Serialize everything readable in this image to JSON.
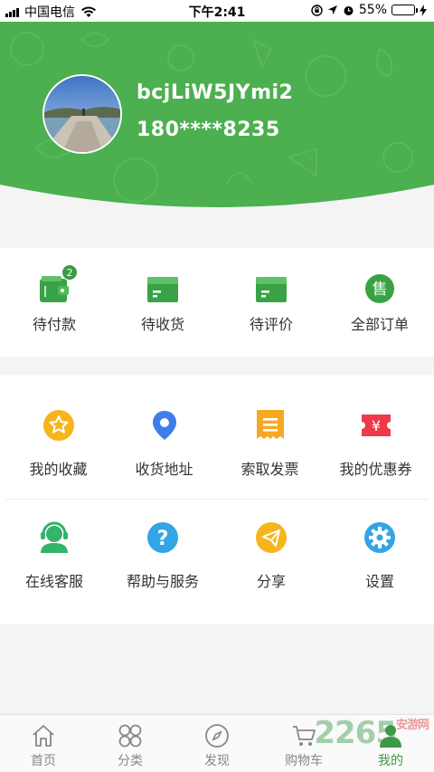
{
  "status_bar": {
    "carrier": "中国电信",
    "time": "下午2:41",
    "battery": "55%",
    "battery_level": 0.55
  },
  "profile": {
    "username": "bcjLiW5JYmi2",
    "phone": "180****8235"
  },
  "orders": [
    {
      "label": "待付款",
      "icon": "wallet-icon",
      "badge": "2"
    },
    {
      "label": "待收货",
      "icon": "box-icon"
    },
    {
      "label": "待评价",
      "icon": "box-icon"
    },
    {
      "label": "全部订单",
      "icon": "sell-icon",
      "glyph": "售"
    }
  ],
  "services_row1": [
    {
      "label": "我的收藏",
      "icon": "star-icon"
    },
    {
      "label": "收货地址",
      "icon": "location-pin-icon"
    },
    {
      "label": "索取发票",
      "icon": "invoice-icon"
    },
    {
      "label": "我的优惠券",
      "icon": "coupon-icon",
      "glyph": "¥"
    }
  ],
  "services_row2": [
    {
      "label": "在线客服",
      "icon": "customer-service-icon"
    },
    {
      "label": "帮助与服务",
      "icon": "help-icon",
      "glyph": "?"
    },
    {
      "label": "分享",
      "icon": "share-icon"
    },
    {
      "label": "设置",
      "icon": "settings-gear-icon"
    }
  ],
  "tabs": [
    {
      "label": "首页",
      "icon": "home-icon"
    },
    {
      "label": "分类",
      "icon": "category-icon"
    },
    {
      "label": "发现",
      "icon": "compass-icon"
    },
    {
      "label": "购物车",
      "icon": "cart-icon"
    },
    {
      "label": "我的",
      "icon": "user-icon",
      "active": true
    }
  ],
  "watermark": {
    "text": "2265",
    "sub": "安游网"
  },
  "colors": {
    "brand_green": "#4caf50",
    "badge_green": "#3c9a46"
  }
}
